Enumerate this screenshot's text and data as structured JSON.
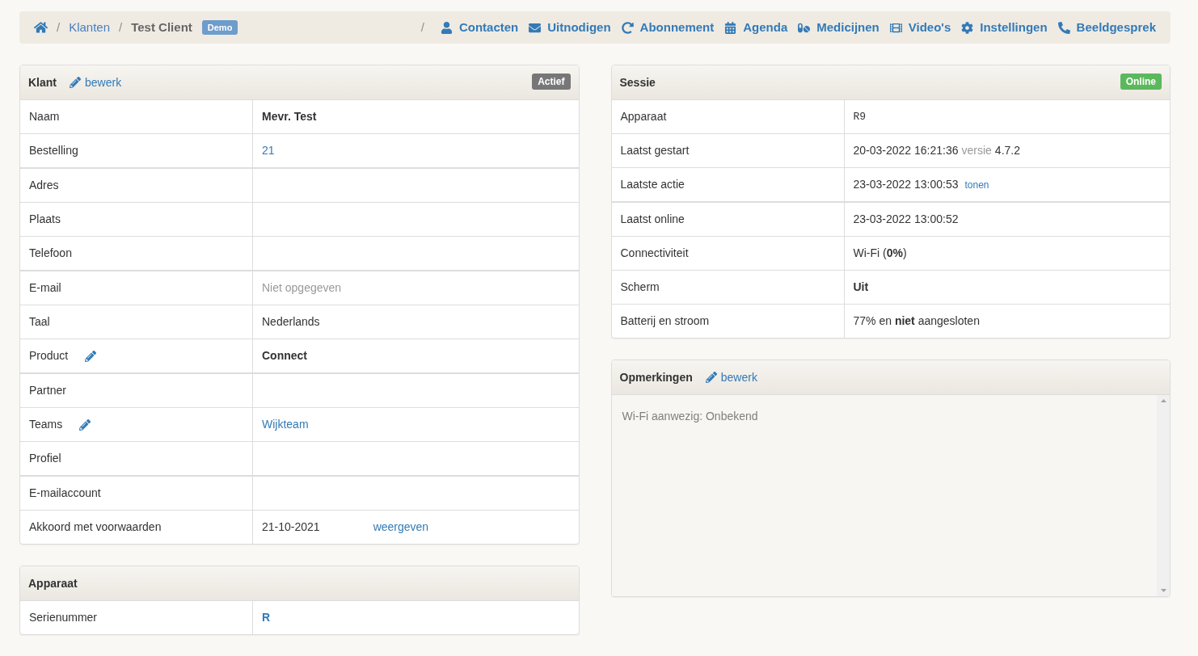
{
  "breadcrumb": {
    "items": [
      {
        "kind": "home"
      },
      {
        "kind": "separator",
        "text": "/"
      },
      {
        "kind": "link",
        "text": "Klanten"
      },
      {
        "kind": "separator",
        "text": "/"
      },
      {
        "kind": "current",
        "text": "Test Client"
      },
      {
        "kind": "badge",
        "text": "Demo"
      }
    ]
  },
  "nav": {
    "separator": "/",
    "links": [
      "Contacten",
      "Uitnodigen",
      "Abonnement",
      "Agenda",
      "Medicijnen",
      "Video's",
      "Instellingen",
      "Beeldgesprek"
    ]
  },
  "left_panels": [
    {
      "title": "Klant",
      "edit_link": "bewerk",
      "badge": {
        "label": "Actief",
        "kind": "default"
      },
      "row_groups": [
        [
          {
            "label": "Naam",
            "editable": false,
            "value": [
              {
                "kind": "bold",
                "text": "Mevr. Test"
              }
            ]
          },
          {
            "label": "Bestelling",
            "editable": false,
            "value": [
              {
                "kind": "link",
                "text": "21"
              }
            ]
          }
        ],
        [
          {
            "label": "Adres",
            "editable": false
          },
          {
            "label": "Plaats",
            "editable": false
          },
          {
            "label": "Telefoon",
            "editable": false
          }
        ],
        [
          {
            "label": "E-mail",
            "editable": false,
            "value": [
              {
                "kind": "muted",
                "text": "Niet opgegeven"
              }
            ]
          },
          {
            "label": "Taal",
            "editable": false,
            "value": [
              {
                "kind": "text",
                "text": "Nederlands"
              }
            ]
          },
          {
            "label": "Product",
            "editable": true,
            "value": [
              {
                "kind": "bold",
                "text": "Connect"
              }
            ]
          }
        ],
        [
          {
            "label": "Partner",
            "editable": false
          },
          {
            "label": "Teams",
            "editable": true,
            "value": [
              {
                "kind": "link",
                "text": "Wijkteam"
              }
            ]
          },
          {
            "label": "Profiel",
            "editable": false
          }
        ],
        [
          {
            "label": "E-mailaccount",
            "editable": false
          },
          {
            "label": "Akkoord met voorwaarden",
            "editable": false,
            "value": [
              {
                "kind": "text",
                "text": "21-10-2021"
              },
              {
                "kind": "link",
                "text": "weergeven"
              }
            ]
          }
        ]
      ]
    },
    {
      "title": "Apparaat",
      "row_groups": [
        [
          {
            "label": "Serienummer",
            "editable": false,
            "value": [
              {
                "kind": "strong_link",
                "text": "R"
              }
            ]
          }
        ]
      ]
    }
  ],
  "right_panels": [
    {
      "title": "Sessie",
      "badge": {
        "label": "Online",
        "kind": "success"
      },
      "row_groups": [
        [
          {
            "label": "Apparaat",
            "editable": false,
            "value": [
              {
                "kind": "mono",
                "text": "R9"
              }
            ]
          },
          {
            "label": "Laatst gestart",
            "editable": false,
            "value": [
              {
                "kind": "text",
                "text": "20-03-2022 16:21:36"
              },
              {
                "kind": "muted",
                "text": "versie"
              },
              {
                "kind": "text",
                "text": "4.7.2"
              }
            ]
          },
          {
            "label": "Laatste actie",
            "editable": false,
            "value": [
              {
                "kind": "text",
                "text": "23-03-2022 13:00:53"
              },
              {
                "kind": "small_link",
                "text": "tonen"
              }
            ]
          }
        ],
        [
          {
            "label": "Laatst online",
            "editable": false,
            "value": [
              {
                "kind": "text",
                "text": "23-03-2022 13:00:52"
              }
            ]
          },
          {
            "label": "Connectiviteit",
            "editable": false,
            "value": [
              {
                "kind": "text",
                "text": "Wi-Fi (**0%**)"
              }
            ]
          },
          {
            "label": "Scherm",
            "editable": false,
            "value": [
              {
                "kind": "bold",
                "text": "Uit"
              }
            ]
          },
          {
            "label": "Batterij en stroom",
            "editable": false,
            "value": [
              {
                "kind": "text",
                "text": "77% en **niet** aangesloten"
              }
            ]
          }
        ]
      ]
    },
    {
      "title": "Opmerkingen",
      "edit_link": "bewerk",
      "notes": "Wi-Fi aanwezig: Onbekend"
    }
  ]
}
